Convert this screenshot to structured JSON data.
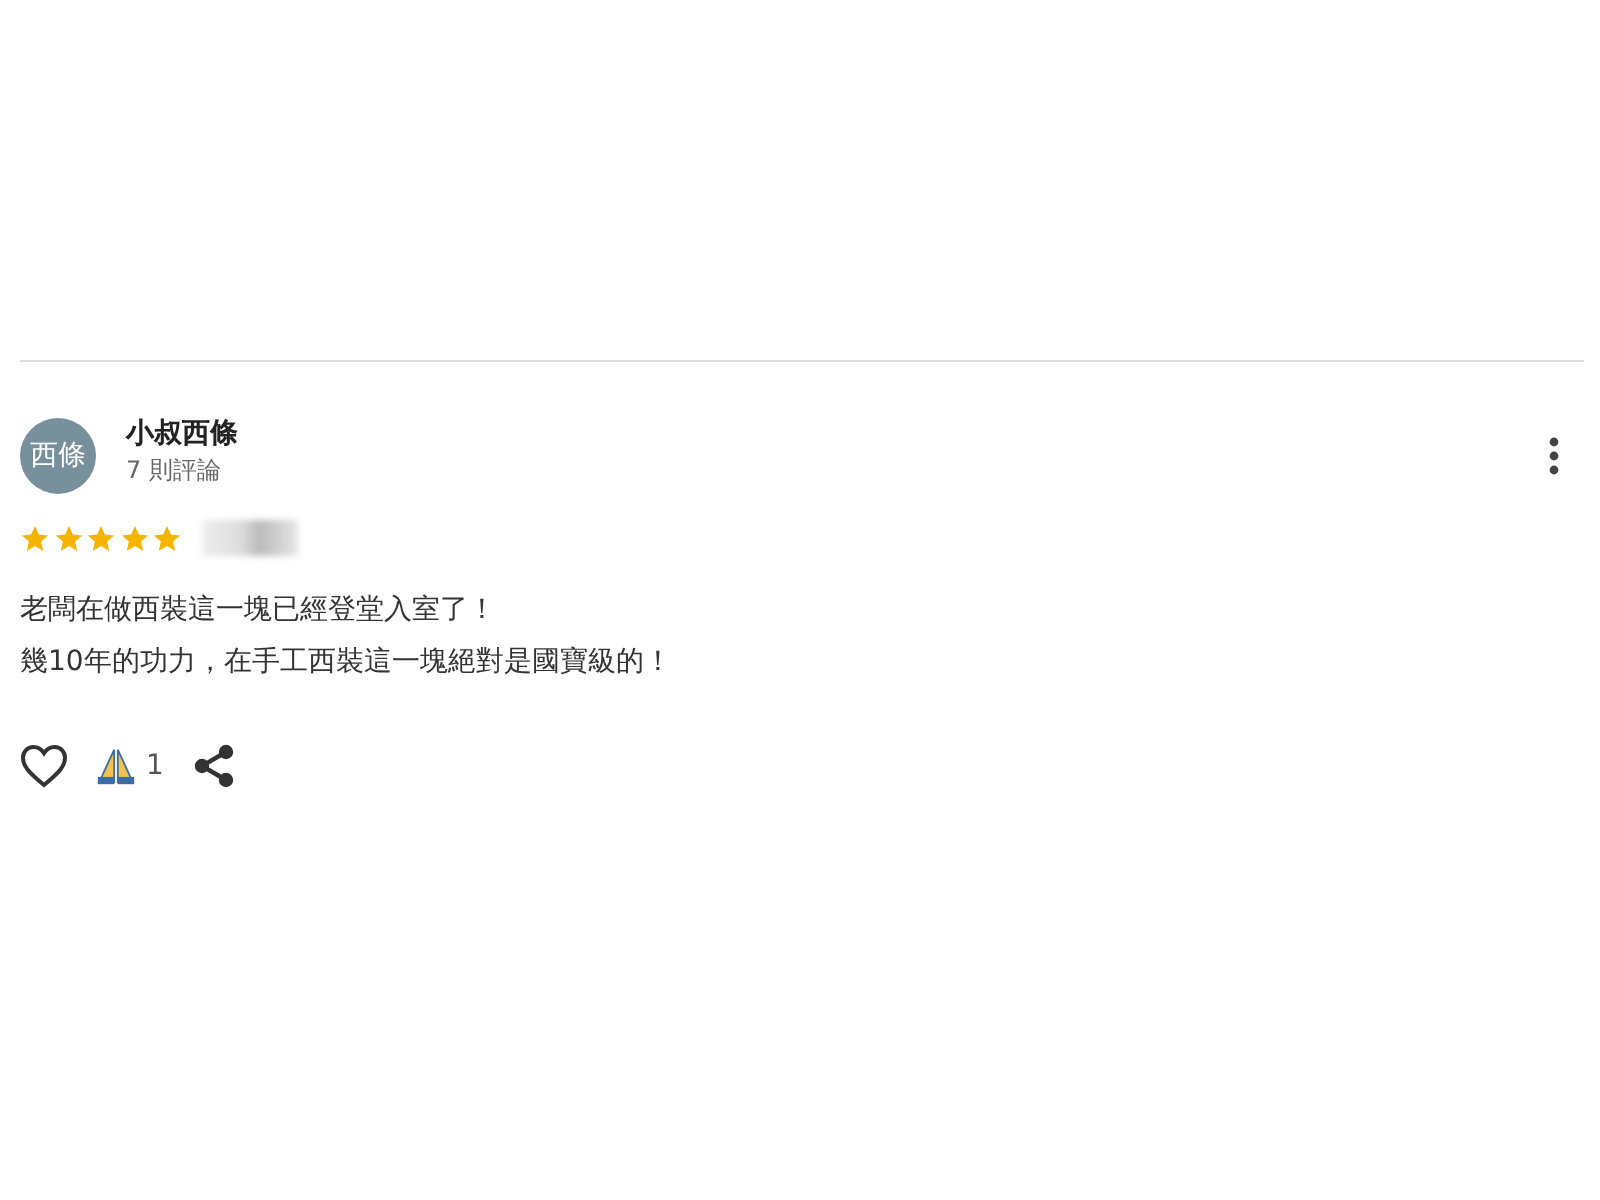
{
  "review": {
    "avatar_text": "西條",
    "author": "小叔西條",
    "review_count": "7 則評論",
    "stars": 5,
    "text_lines": [
      "老闆在做西裝這一塊已經登堂入室了！",
      "幾10年的功力，在手工西裝這一塊絕對是國寶級的！"
    ],
    "liked": false,
    "reaction_count": "1"
  }
}
